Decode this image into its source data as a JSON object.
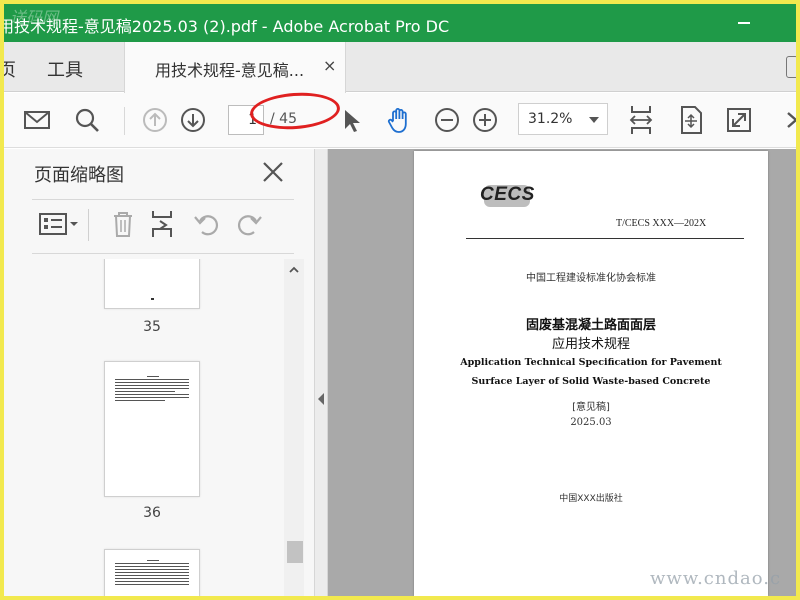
{
  "window": {
    "title": "用技术规程-意见稿2025.03 (2).pdf - Adobe Acrobat Pro DC",
    "watermark": "送码网"
  },
  "tabs": {
    "home": "页",
    "tools": "工具",
    "document": "用技术规程-意见稿...",
    "close_glyph": "×"
  },
  "toolbar": {
    "current_page": "1",
    "total_pages": "/ 45",
    "zoom": "31.2%"
  },
  "sidebar": {
    "title": "页面缩略图",
    "thumbnails": [
      {
        "label": "35"
      },
      {
        "label": "36"
      }
    ]
  },
  "document": {
    "logo": "CECS",
    "standard_number": "T/CECS XXX—202X",
    "association": "中国工程建设标准化协会标准",
    "title_cn_line1": "固废基混凝土路面面层",
    "title_cn_line2": "应用技术规程",
    "title_en_line1": "Application Technical Specification for Pavement",
    "title_en_line2": "Surface Layer of Solid Waste-based Concrete",
    "draft_tag": "[意见稿]",
    "date": "2025.03",
    "publisher": "中国XXX出版社"
  },
  "overlay": {
    "site_watermark": "www.cndao.c"
  },
  "colors": {
    "titlebar": "#1f9a48",
    "annotation_circle": "#e02020",
    "frame_border": "#f2e94e"
  }
}
